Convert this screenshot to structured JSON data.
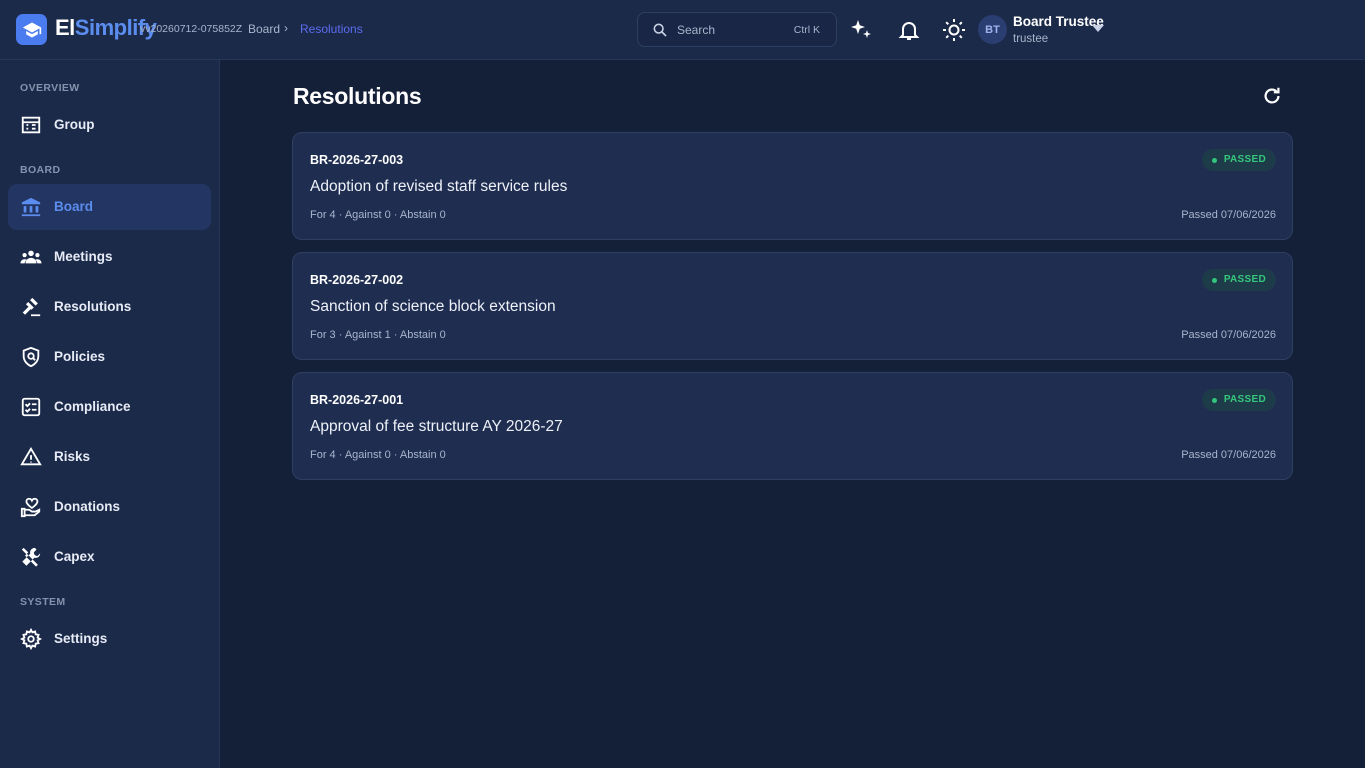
{
  "header": {
    "brand_part1": "El",
    "brand_part2": "Simplify",
    "version": "vv20260712-075852Z",
    "breadcrumb": {
      "parent": "Board",
      "separator": "›",
      "current": "Resolutions"
    },
    "search": {
      "placeholder": "Search",
      "shortcut": "Ctrl K"
    },
    "user": {
      "initials": "BT",
      "name": "Board Trustee",
      "role": "trustee"
    }
  },
  "sidebar": {
    "sections": [
      {
        "label": "OVERVIEW"
      },
      {
        "label": "BOARD"
      },
      {
        "label": "SYSTEM"
      }
    ],
    "items": [
      {
        "label": "Group",
        "icon": "building-icon"
      },
      {
        "label": "Board",
        "icon": "bank-icon",
        "active": true
      },
      {
        "label": "Meetings",
        "icon": "people-icon"
      },
      {
        "label": "Resolutions",
        "icon": "gavel-icon"
      },
      {
        "label": "Policies",
        "icon": "shield-icon"
      },
      {
        "label": "Compliance",
        "icon": "checklist-icon"
      },
      {
        "label": "Risks",
        "icon": "warning-icon"
      },
      {
        "label": "Donations",
        "icon": "donation-icon"
      },
      {
        "label": "Capex",
        "icon": "tools-icon"
      },
      {
        "label": "Settings",
        "icon": "gear-icon"
      }
    ]
  },
  "main": {
    "title": "Resolutions",
    "resolutions": [
      {
        "id": "BR-2026-27-003",
        "title": "Adoption of revised staff service rules",
        "votes": "For 4 · Against 0 · Abstain 0",
        "status": "PASSED",
        "date": "Passed 07/06/2026"
      },
      {
        "id": "BR-2026-27-002",
        "title": "Sanction of science block extension",
        "votes": "For 3 · Against 1 · Abstain 0",
        "status": "PASSED",
        "date": "Passed 07/06/2026"
      },
      {
        "id": "BR-2026-27-001",
        "title": "Approval of fee structure AY 2026-27",
        "votes": "For 4 · Against 0 · Abstain 0",
        "status": "PASSED",
        "date": "Passed 07/06/2026"
      }
    ]
  },
  "colors": {
    "accent": "#5b8def",
    "passed": "#34c77b",
    "background": "#141f38",
    "panel": "#1c2a4a"
  }
}
